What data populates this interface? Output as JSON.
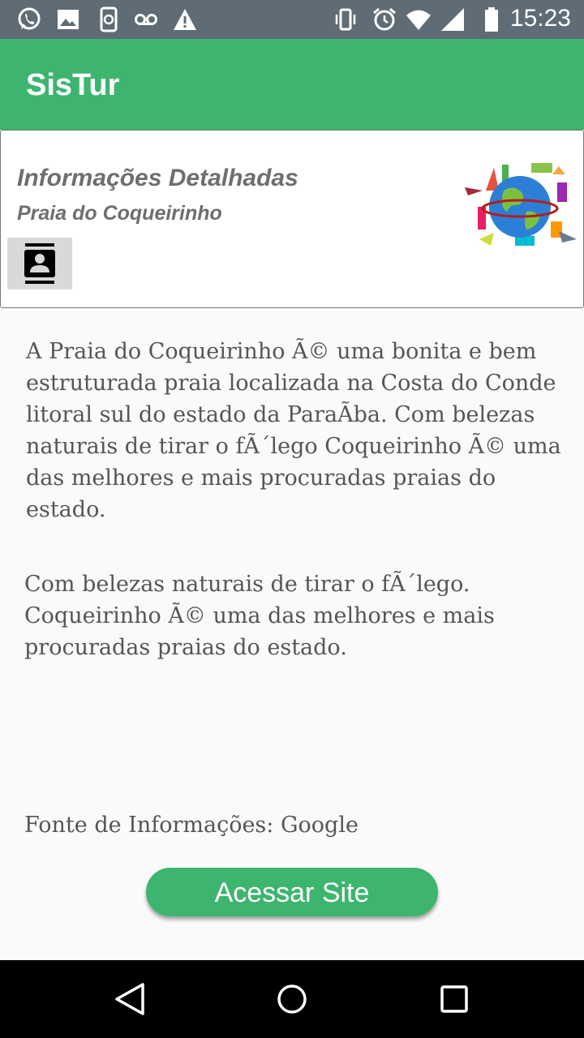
{
  "status_bar": {
    "time": "15:23",
    "icons": [
      "whatsapp-icon",
      "image-icon",
      "phone-sync-icon",
      "voicemail-icon",
      "warning-icon",
      "vibrate-icon",
      "alarm-icon",
      "wifi-icon",
      "signal-icon",
      "battery-icon"
    ]
  },
  "app_bar": {
    "title": "SisTur"
  },
  "card": {
    "title": "Informações Detalhadas",
    "subtitle": "Praia do Coqueirinho",
    "contact_icon": "contacts-icon",
    "image_icon": "globe-travel-icon"
  },
  "content": {
    "paragraph1": "A Praia do Coqueirinho Ã© uma bonita e bem estruturada praia localizada na Costa do Conde litoral sul do estado da ParaÃ­ba. Com belezas naturais de tirar o fÃ´lego Coqueirinho Ã© uma das melhores e mais procuradas praias do estado.",
    "paragraph2": "Com belezas naturais de tirar o fÃ´lego. Coqueirinho Ã© uma das melhores e mais procuradas praias do estado.",
    "source": "Fonte de Informações: Google"
  },
  "actions": {
    "site_button": "Acessar Site"
  },
  "nav_bar": {
    "icons": [
      "back-icon",
      "home-icon",
      "recents-icon"
    ]
  },
  "colors": {
    "accent": "#3db56e",
    "status_bar": "#5f6c75"
  }
}
